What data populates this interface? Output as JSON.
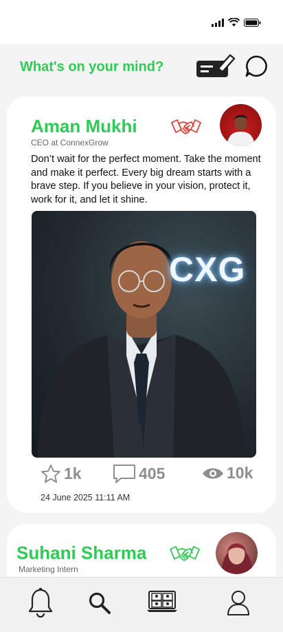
{
  "composer": {
    "prompt": "What's on your mind?"
  },
  "posts": [
    {
      "author": "Aman Mukhi",
      "role": "CEO at ConnexGrow",
      "text": "Don’t wait for the perfect moment. Take the moment and make it perfect. Every big dream starts with a brave step. If you believe in your vision, protect it, work for it, and let it shine.",
      "photo_caption": "CXG",
      "stats": {
        "stars": "1k",
        "comments": "405",
        "views": "10k"
      },
      "timestamp": "24 June 2025 11:11 AM",
      "connect_icon_color": "#e0413a"
    },
    {
      "author": "Suhani Sharma",
      "role": "Marketing Intern",
      "connect_icon_color": "#2ecc55"
    }
  ],
  "nav": {
    "items": [
      "bell-icon",
      "search-icon",
      "community-icon",
      "profile-icon"
    ]
  },
  "colors": {
    "accent": "#2ecc55",
    "muted": "#8e8e8e",
    "background": "#f4f4f4"
  }
}
